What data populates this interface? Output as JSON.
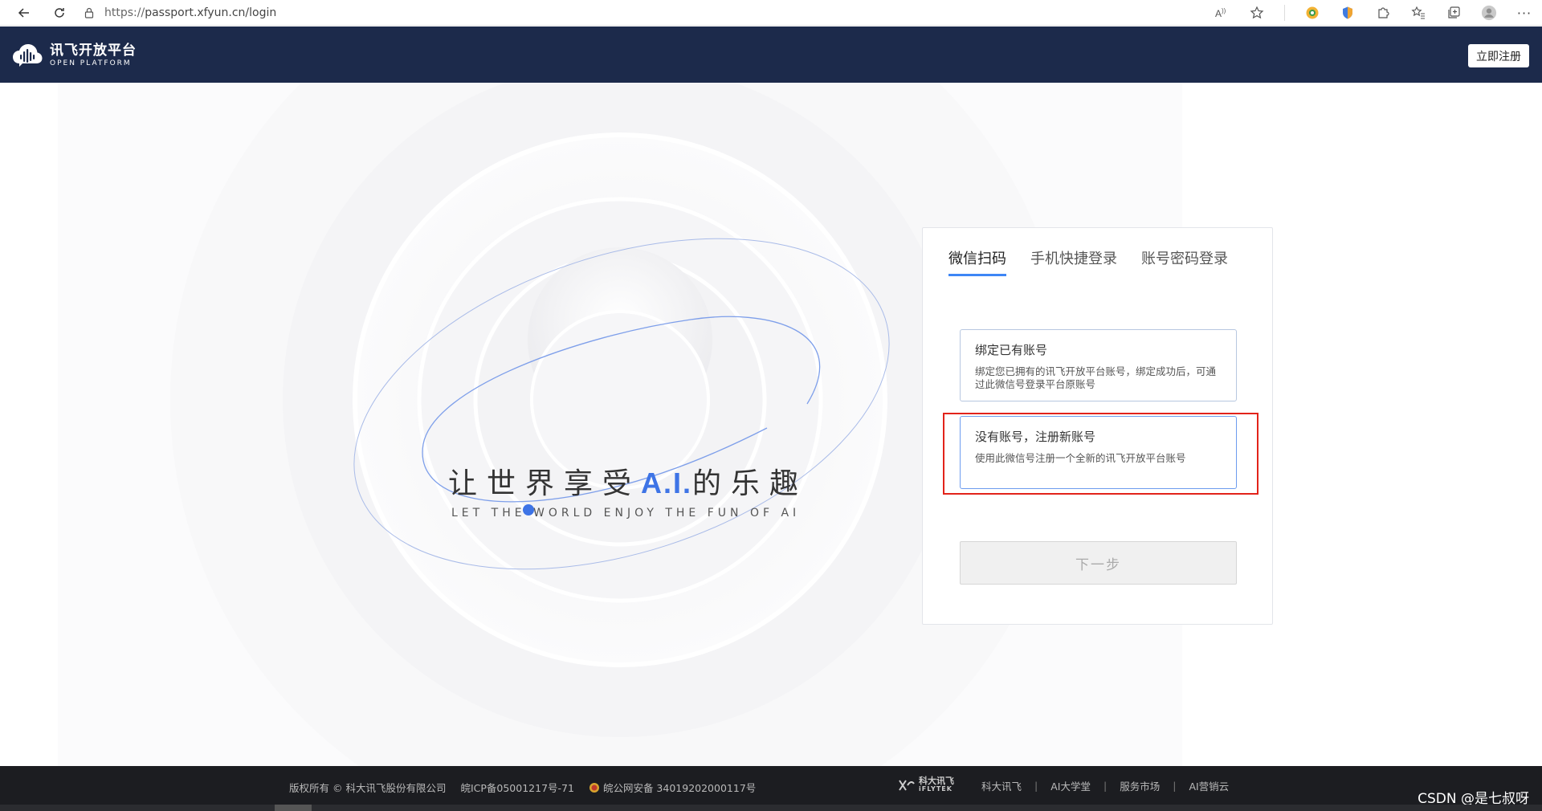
{
  "browser": {
    "url_proto": "https://",
    "url_rest": "passport.xfyun.cn/login"
  },
  "header": {
    "logo_cn": "讯飞开放平台",
    "logo_en": "OPEN PLATFORM",
    "register": "立即注册"
  },
  "slogan": {
    "cn_prefix": "让世界享受",
    "ai": "A.I.",
    "cn_suffix": "的乐趣",
    "en": "LET THE WORLD ENJOY THE FUN OF AI"
  },
  "login": {
    "tabs": [
      {
        "label": "微信扫码",
        "active": true
      },
      {
        "label": "手机快捷登录",
        "active": false
      },
      {
        "label": "账号密码登录",
        "active": false
      }
    ],
    "options": [
      {
        "title": "绑定已有账号",
        "desc": "绑定您已拥有的讯飞开放平台账号，绑定成功后，可通过此微信号登录平台原账号"
      },
      {
        "title": "没有账号，注册新账号",
        "desc": "使用此微信号注册一个全新的讯飞开放平台账号"
      }
    ],
    "next": "下一步"
  },
  "footer": {
    "copyright": "版权所有 © 科大讯飞股份有限公司",
    "icp": "皖ICP备05001217号-71",
    "police": "皖公网安备 34019202000117号",
    "brand_cn": "科大讯飞",
    "brand_en": "iFLYTEK",
    "links": [
      "科大讯飞",
      "AI大学堂",
      "服务市场",
      "AI营销云"
    ],
    "watermark": "CSDN @是七叔呀"
  },
  "colors": {
    "header_bg": "#1c2a4b",
    "accent": "#3e74e6",
    "highlight": "#e2231a"
  }
}
